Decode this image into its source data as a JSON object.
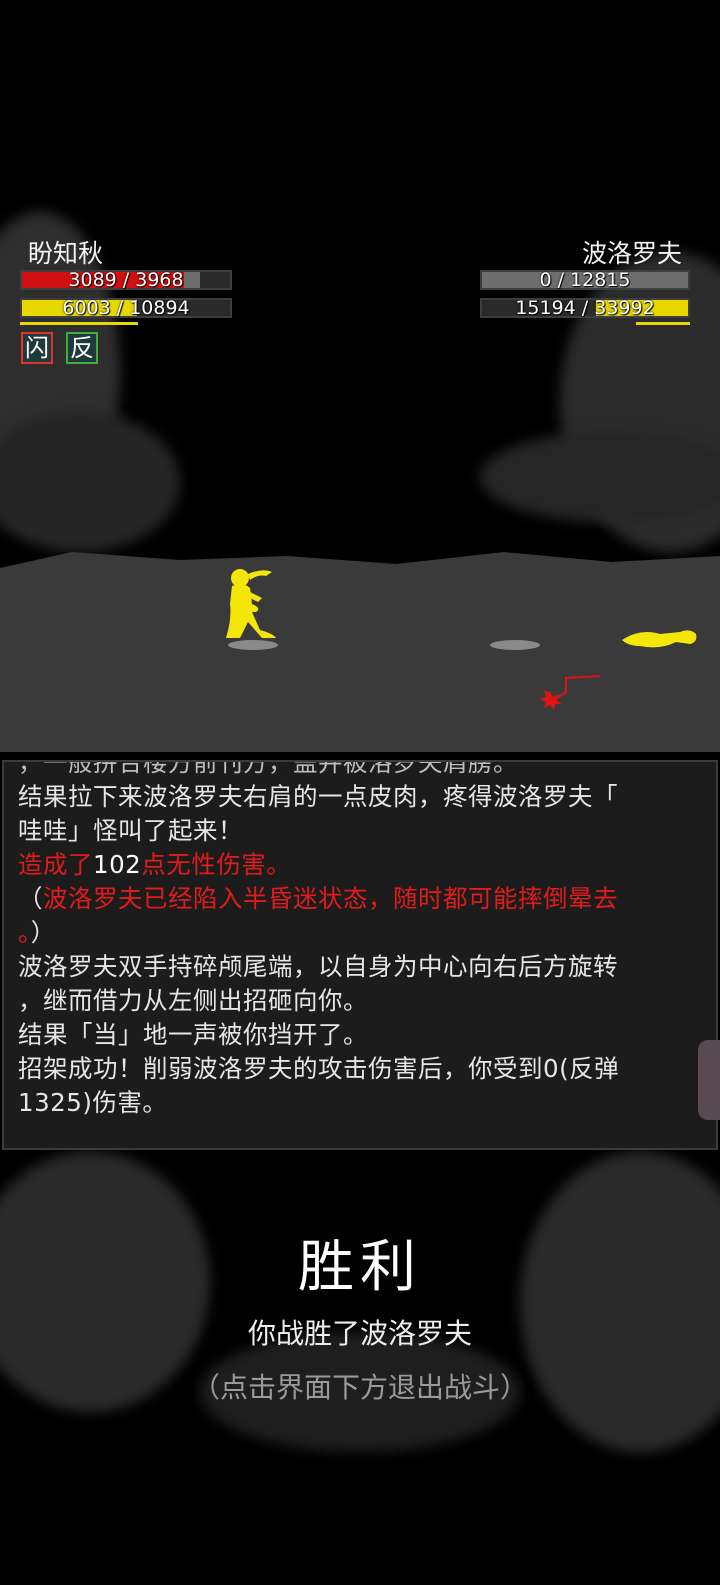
{
  "player": {
    "name": "盼知秋",
    "hp_text": "3089 / 3968",
    "hp_fraction": 0.778,
    "hp_color": "#d01010",
    "mp_text": "6003 / 10894",
    "mp_fraction": 0.551,
    "mp_color": "#e6d800",
    "badges": [
      {
        "label": "闪",
        "border": "#e03030"
      },
      {
        "label": "反",
        "border": "#3fae3f"
      }
    ]
  },
  "enemy": {
    "name": "波洛罗夫",
    "hp_text": "0 / 12815",
    "hp_fraction": 0.0,
    "mp_text": "15194 / 33992",
    "mp_fraction": 0.447,
    "mp_color": "#e6d800"
  },
  "log": {
    "line_cut": "，一般拼合楼方前刊方，盖并被洛罗夫肩膀。",
    "line1": "结果拉下来波洛罗夫右肩的一点皮肉，疼得波洛罗夫「",
    "line2": "哇哇」怪叫了起来！",
    "dmg_pre": "造成了",
    "dmg_num": "102",
    "dmg_post": "点无性伤害。",
    "status_open": "（",
    "status_text": "波洛罗夫已经陷入半昏迷状态，随时都可能摔倒晕去",
    "status_tail": "。",
    "status_close": "）",
    "line5": "波洛罗夫双手持碎颅尾端，以自身为中心向右后方旋转",
    "line6": "，继而借力从左侧出招砸向你。",
    "line7": "结果「当」地一声被你挡开了。",
    "line8": "招架成功！削弱波洛罗夫的攻击伤害后，你受到0(反弹",
    "line9": "1325)伤害。"
  },
  "result": {
    "title": "胜利",
    "subtitle": "你战胜了波洛罗夫",
    "hint": "（点击界面下方退出战斗）"
  }
}
